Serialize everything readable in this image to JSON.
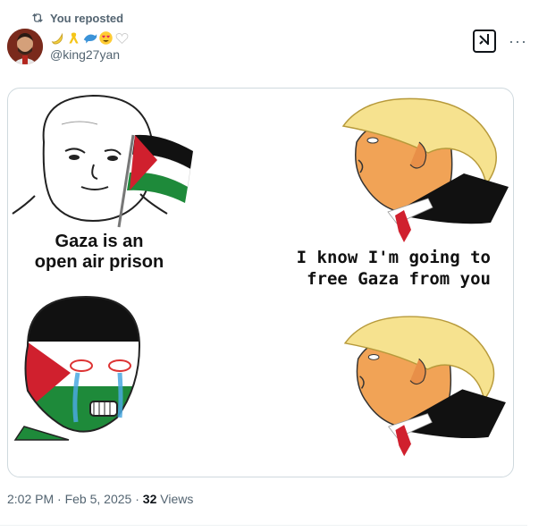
{
  "repost": {
    "label": "You reposted"
  },
  "author": {
    "name_emojis": [
      "banana",
      "yellow-ribbon",
      "dolphin",
      "heart-eyes",
      "white-heart"
    ],
    "handle": "@king27yan"
  },
  "header": {
    "grok_icon": "grok-icon",
    "more_label": "···"
  },
  "meme": {
    "caption_left": "Gaza is an\nopen air prison",
    "caption_right": "I know I'm going to\nfree Gaza from you"
  },
  "meta": {
    "time": "2:02 PM",
    "sep1": "·",
    "date": "Feb 5, 2025",
    "sep2": "·",
    "views_count": "32",
    "views_label": "Views"
  },
  "colors": {
    "flag_black": "#000000",
    "flag_green": "#1e8a3a",
    "flag_red": "#d0202e",
    "secondary_text": "#536471",
    "border": "#cfd9de"
  }
}
